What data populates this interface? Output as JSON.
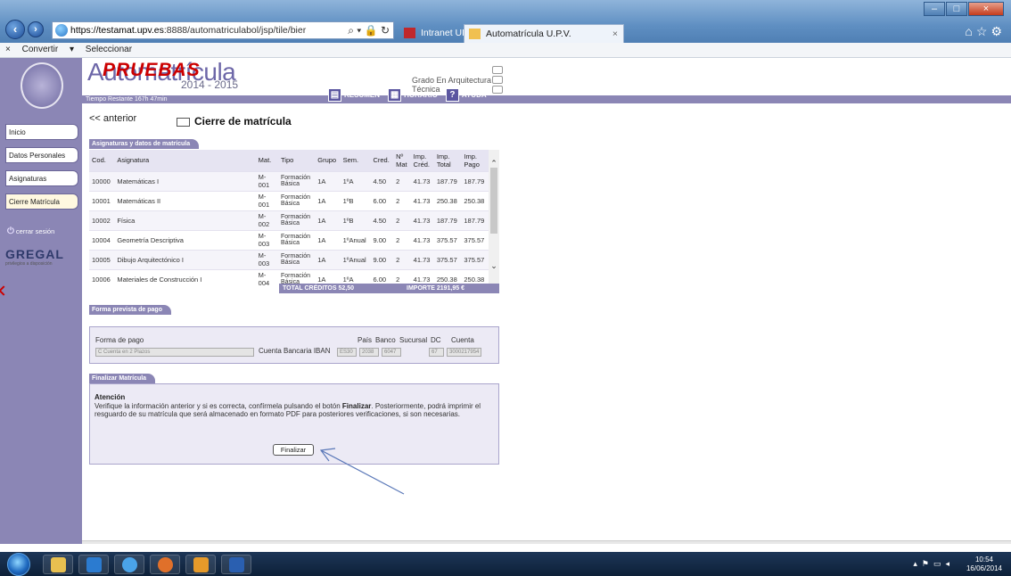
{
  "browser": {
    "url_prefix": "https://testamat.upv.es",
    "url_rest": ":8888/automatriculabol/jsp/tile/bier",
    "tabs": [
      {
        "label": "Intranet UPV"
      },
      {
        "label": "Automatrícula U.P.V."
      }
    ],
    "commands": [
      {
        "label": "Convertir"
      },
      {
        "label": "Seleccionar"
      }
    ]
  },
  "header": {
    "app_title": "Automatrícula",
    "watermark": "PRUEBAS",
    "year": "2014 - 2015",
    "grado": "Grado En Arquitectura Técnica",
    "tiempo": "Tiempo Restante 167h 47min",
    "tools": [
      {
        "label": "RESUMEN"
      },
      {
        "label": "HORARIO"
      },
      {
        "label": "AYUDA"
      }
    ]
  },
  "sidebar": {
    "items": [
      {
        "label": "Inicio"
      },
      {
        "label": "Datos Personales"
      },
      {
        "label": "Asignaturas"
      },
      {
        "label": "Cierre Matrícula"
      }
    ],
    "logout": "cerrar sesión",
    "brand": "GREGAL",
    "brand_sub": "privilegios a disposición"
  },
  "main": {
    "back": "<< anterior",
    "title": "Cierre de matrícula",
    "subjects_section": "Asignaturas y datos de matrícula",
    "columns": [
      "Cod.",
      "Asignatura",
      "Mat.",
      "Tipo",
      "Grupo",
      "Sem.",
      "Cred.",
      "Nº Mat",
      "Imp. Créd.",
      "Imp. Total",
      "Imp. Pago"
    ],
    "rows": [
      {
        "cod": "10000",
        "asig": "Matemáticas I",
        "mat": "M-001",
        "tipo": "Formación Básica",
        "grupo": "1A",
        "sem": "1ºA",
        "cred": "4.50",
        "nmat": "2",
        "impcred": "41.73",
        "imptotal": "187.79",
        "imppago": "187.79"
      },
      {
        "cod": "10001",
        "asig": "Matemáticas II",
        "mat": "M-001",
        "tipo": "Formación Básica",
        "grupo": "1A",
        "sem": "1ºB",
        "cred": "6.00",
        "nmat": "2",
        "impcred": "41.73",
        "imptotal": "250.38",
        "imppago": "250.38"
      },
      {
        "cod": "10002",
        "asig": "Física",
        "mat": "M-002",
        "tipo": "Formación Básica",
        "grupo": "1A",
        "sem": "1ºB",
        "cred": "4.50",
        "nmat": "2",
        "impcred": "41.73",
        "imptotal": "187.79",
        "imppago": "187.79"
      },
      {
        "cod": "10004",
        "asig": "Geometría Descriptiva",
        "mat": "M-003",
        "tipo": "Formación Básica",
        "grupo": "1A",
        "sem": "1ºAnual",
        "cred": "9.00",
        "nmat": "2",
        "impcred": "41.73",
        "imptotal": "375.57",
        "imppago": "375.57"
      },
      {
        "cod": "10005",
        "asig": "Dibujo Arquitectónico I",
        "mat": "M-003",
        "tipo": "Formación Básica",
        "grupo": "1A",
        "sem": "1ºAnual",
        "cred": "9.00",
        "nmat": "2",
        "impcred": "41.73",
        "imptotal": "375.57",
        "imppago": "375.57"
      },
      {
        "cod": "10006",
        "asig": "Materiales de Construcción I",
        "mat": "M-004",
        "tipo": "Formación Básica",
        "grupo": "1A",
        "sem": "1ºA",
        "cred": "6.00",
        "nmat": "2",
        "impcred": "41.73",
        "imptotal": "250.38",
        "imppago": "250.38"
      }
    ],
    "total_creditos": "TOTAL CRÉDITOS  52,50",
    "importe": "IMPORTE  2191,95 €",
    "payment_section": "Forma prevista de pago",
    "forma_pago_label": "Forma de pago",
    "forma_pago_value": "C Cuenta en 2 Plazos",
    "cuenta_label": "Cuenta Bancaria IBAN",
    "pago_headers": [
      "País",
      "Banco",
      "Sucursal",
      "DC",
      "Cuenta"
    ],
    "iban": "ES30",
    "banco": "2038",
    "sucursal": "6047",
    "dc": "67",
    "cuenta": "3000217954",
    "finalize_section": "Finalizar Matrícula",
    "atencion": "Atención",
    "aviso_1": "Verifique la información anterior y si es correcta, confírmela pulsando el botón ",
    "aviso_bold": "Finalizar",
    "aviso_2": ". Posteriormente, podrá imprimir el resguardo de su matrícula que será almacenado en formato PDF para posteriores verificaciones, si son necesarias.",
    "finalize_button": "Finalizar"
  },
  "taskbar": {
    "time": "10:54",
    "date": "16/06/2014"
  },
  "colors": {
    "accent": "#8b86b5",
    "panel": "#eceaf5",
    "watermark": "#cc0000"
  }
}
